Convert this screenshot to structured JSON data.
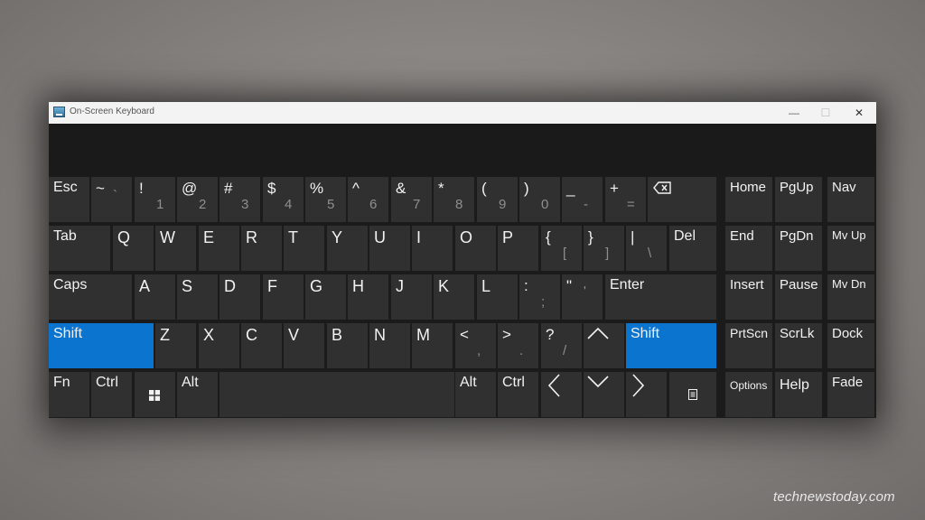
{
  "window": {
    "title": "On-Screen Keyboard",
    "min": "—",
    "max": "☐",
    "close": "✕"
  },
  "keys": {
    "esc": "Esc",
    "tilde": "~",
    "tilde_sub": "`",
    "n1": "!",
    "n1_sub": "1",
    "n2": "@",
    "n2_sub": "2",
    "n3": "#",
    "n3_sub": "3",
    "n4": "$",
    "n4_sub": "4",
    "n5": "%",
    "n5_sub": "5",
    "n6": "^",
    "n6_sub": "6",
    "n7": "&",
    "n7_sub": "7",
    "n8": "*",
    "n8_sub": "8",
    "n9": "(",
    "n9_sub": "9",
    "n0": ")",
    "n0_sub": "0",
    "minus": "_",
    "minus_sub": "-",
    "plus": "+",
    "plus_sub": "=",
    "tab": "Tab",
    "q": "Q",
    "w": "W",
    "e": "E",
    "r": "R",
    "t": "T",
    "y": "Y",
    "u": "U",
    "i": "I",
    "o": "O",
    "p": "P",
    "lbrace": "{",
    "lbrace_sub": "[",
    "rbrace": "}",
    "rbrace_sub": "]",
    "pipe": "|",
    "pipe_sub": "\\",
    "del": "Del",
    "caps": "Caps",
    "a": "A",
    "s": "S",
    "d": "D",
    "f": "F",
    "g": "G",
    "h": "H",
    "j": "J",
    "k": "K",
    "l": "L",
    "colon": ":",
    "colon_sub": ";",
    "quote": "\"",
    "quote_sub": "'",
    "enter": "Enter",
    "shift_left": "Shift",
    "z": "Z",
    "x": "X",
    "c": "C",
    "v": "V",
    "b": "B",
    "n": "N",
    "m": "M",
    "lt": "<",
    "lt_sub": ",",
    "gt": ">",
    "gt_sub": ".",
    "question": "?",
    "question_sub": "/",
    "shift_right": "Shift",
    "fn": "Fn",
    "ctrl_left": "Ctrl",
    "alt_left": "Alt",
    "alt_right": "Alt",
    "ctrl_right": "Ctrl",
    "home": "Home",
    "pgup": "PgUp",
    "nav": "Nav",
    "end": "End",
    "pgdn": "PgDn",
    "mvup": "Mv Up",
    "insert": "Insert",
    "pause": "Pause",
    "mvdn": "Mv Dn",
    "prtscn": "PrtScn",
    "scrlk": "ScrLk",
    "dock": "Dock",
    "options": "Options",
    "help": "Help",
    "fade": "Fade"
  },
  "icons": {
    "backspace": "backspace-icon",
    "up": "arrow-up-icon",
    "down": "arrow-down-icon",
    "left": "arrow-left-icon",
    "right": "arrow-right-icon",
    "windows": "windows-logo-icon",
    "menu": "context-menu-icon"
  },
  "colors": {
    "key": "#303030",
    "key_active": "#0a74cf",
    "window": "#1b1b1b"
  },
  "watermark": "technewstoday.com"
}
